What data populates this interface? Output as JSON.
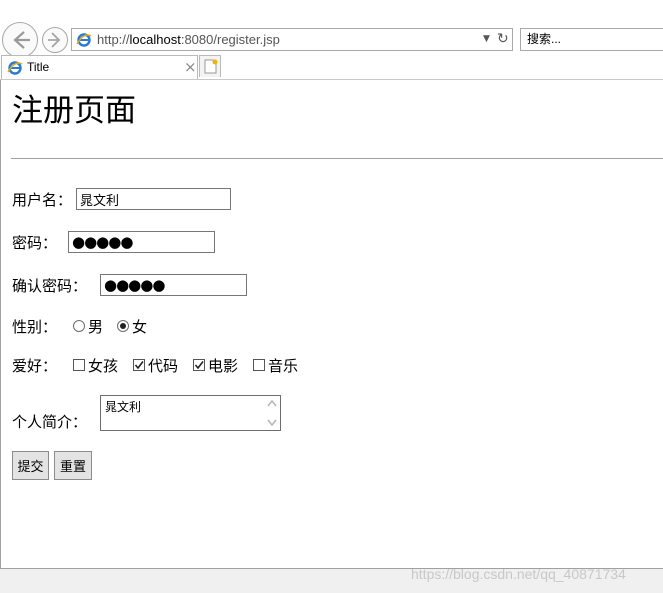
{
  "browser": {
    "url_prefix": "http://",
    "url_host": "localhost",
    "url_rest": ":8080/register.jsp",
    "search_placeholder": "搜索...",
    "tab_title": "Title"
  },
  "page": {
    "heading": "注册页面",
    "form": {
      "username_label": "用户名：",
      "username_value": "晁文利",
      "password_label": "密码：",
      "password_value": "●●●●●",
      "confirm_label": "确认密码：",
      "confirm_value": "●●●●●",
      "gender_label": "性别：",
      "gender_options": [
        {
          "label": "男",
          "checked": false
        },
        {
          "label": "女",
          "checked": true
        }
      ],
      "hobby_label": "爱好：",
      "hobbies": [
        {
          "label": "女孩",
          "checked": false
        },
        {
          "label": "代码",
          "checked": true
        },
        {
          "label": "电影",
          "checked": true
        },
        {
          "label": "音乐",
          "checked": false
        }
      ],
      "intro_label": "个人简介：",
      "intro_value": "晁文利",
      "submit_label": "提交",
      "reset_label": "重置"
    }
  },
  "watermark": "https://blog.csdn.net/qq_40871734"
}
